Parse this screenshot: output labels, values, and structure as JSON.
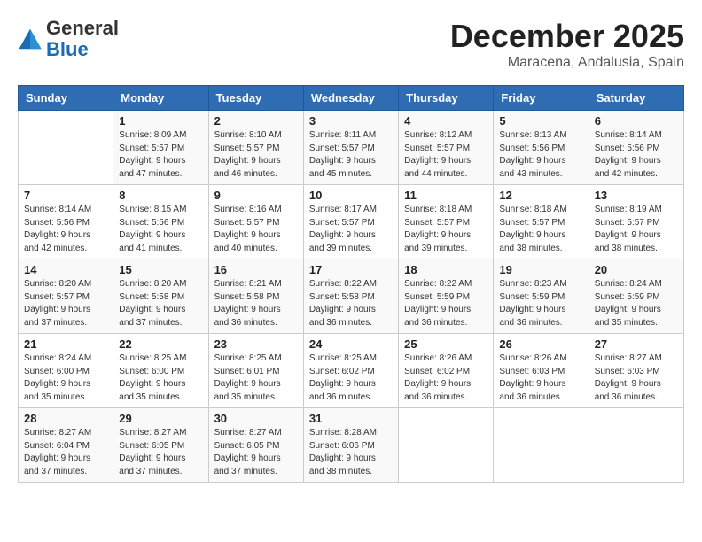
{
  "logo": {
    "general": "General",
    "blue": "Blue"
  },
  "header": {
    "month": "December 2025",
    "location": "Maracena, Andalusia, Spain"
  },
  "weekdays": [
    "Sunday",
    "Monday",
    "Tuesday",
    "Wednesday",
    "Thursday",
    "Friday",
    "Saturday"
  ],
  "weeks": [
    [
      {
        "day": "",
        "info": ""
      },
      {
        "day": "1",
        "info": "Sunrise: 8:09 AM\nSunset: 5:57 PM\nDaylight: 9 hours\nand 47 minutes."
      },
      {
        "day": "2",
        "info": "Sunrise: 8:10 AM\nSunset: 5:57 PM\nDaylight: 9 hours\nand 46 minutes."
      },
      {
        "day": "3",
        "info": "Sunrise: 8:11 AM\nSunset: 5:57 PM\nDaylight: 9 hours\nand 45 minutes."
      },
      {
        "day": "4",
        "info": "Sunrise: 8:12 AM\nSunset: 5:57 PM\nDaylight: 9 hours\nand 44 minutes."
      },
      {
        "day": "5",
        "info": "Sunrise: 8:13 AM\nSunset: 5:56 PM\nDaylight: 9 hours\nand 43 minutes."
      },
      {
        "day": "6",
        "info": "Sunrise: 8:14 AM\nSunset: 5:56 PM\nDaylight: 9 hours\nand 42 minutes."
      }
    ],
    [
      {
        "day": "7",
        "info": "Sunrise: 8:14 AM\nSunset: 5:56 PM\nDaylight: 9 hours\nand 42 minutes."
      },
      {
        "day": "8",
        "info": "Sunrise: 8:15 AM\nSunset: 5:56 PM\nDaylight: 9 hours\nand 41 minutes."
      },
      {
        "day": "9",
        "info": "Sunrise: 8:16 AM\nSunset: 5:57 PM\nDaylight: 9 hours\nand 40 minutes."
      },
      {
        "day": "10",
        "info": "Sunrise: 8:17 AM\nSunset: 5:57 PM\nDaylight: 9 hours\nand 39 minutes."
      },
      {
        "day": "11",
        "info": "Sunrise: 8:18 AM\nSunset: 5:57 PM\nDaylight: 9 hours\nand 39 minutes."
      },
      {
        "day": "12",
        "info": "Sunrise: 8:18 AM\nSunset: 5:57 PM\nDaylight: 9 hours\nand 38 minutes."
      },
      {
        "day": "13",
        "info": "Sunrise: 8:19 AM\nSunset: 5:57 PM\nDaylight: 9 hours\nand 38 minutes."
      }
    ],
    [
      {
        "day": "14",
        "info": "Sunrise: 8:20 AM\nSunset: 5:57 PM\nDaylight: 9 hours\nand 37 minutes."
      },
      {
        "day": "15",
        "info": "Sunrise: 8:20 AM\nSunset: 5:58 PM\nDaylight: 9 hours\nand 37 minutes."
      },
      {
        "day": "16",
        "info": "Sunrise: 8:21 AM\nSunset: 5:58 PM\nDaylight: 9 hours\nand 36 minutes."
      },
      {
        "day": "17",
        "info": "Sunrise: 8:22 AM\nSunset: 5:58 PM\nDaylight: 9 hours\nand 36 minutes."
      },
      {
        "day": "18",
        "info": "Sunrise: 8:22 AM\nSunset: 5:59 PM\nDaylight: 9 hours\nand 36 minutes."
      },
      {
        "day": "19",
        "info": "Sunrise: 8:23 AM\nSunset: 5:59 PM\nDaylight: 9 hours\nand 36 minutes."
      },
      {
        "day": "20",
        "info": "Sunrise: 8:24 AM\nSunset: 5:59 PM\nDaylight: 9 hours\nand 35 minutes."
      }
    ],
    [
      {
        "day": "21",
        "info": "Sunrise: 8:24 AM\nSunset: 6:00 PM\nDaylight: 9 hours\nand 35 minutes."
      },
      {
        "day": "22",
        "info": "Sunrise: 8:25 AM\nSunset: 6:00 PM\nDaylight: 9 hours\nand 35 minutes."
      },
      {
        "day": "23",
        "info": "Sunrise: 8:25 AM\nSunset: 6:01 PM\nDaylight: 9 hours\nand 35 minutes."
      },
      {
        "day": "24",
        "info": "Sunrise: 8:25 AM\nSunset: 6:02 PM\nDaylight: 9 hours\nand 36 minutes."
      },
      {
        "day": "25",
        "info": "Sunrise: 8:26 AM\nSunset: 6:02 PM\nDaylight: 9 hours\nand 36 minutes."
      },
      {
        "day": "26",
        "info": "Sunrise: 8:26 AM\nSunset: 6:03 PM\nDaylight: 9 hours\nand 36 minutes."
      },
      {
        "day": "27",
        "info": "Sunrise: 8:27 AM\nSunset: 6:03 PM\nDaylight: 9 hours\nand 36 minutes."
      }
    ],
    [
      {
        "day": "28",
        "info": "Sunrise: 8:27 AM\nSunset: 6:04 PM\nDaylight: 9 hours\nand 37 minutes."
      },
      {
        "day": "29",
        "info": "Sunrise: 8:27 AM\nSunset: 6:05 PM\nDaylight: 9 hours\nand 37 minutes."
      },
      {
        "day": "30",
        "info": "Sunrise: 8:27 AM\nSunset: 6:05 PM\nDaylight: 9 hours\nand 37 minutes."
      },
      {
        "day": "31",
        "info": "Sunrise: 8:28 AM\nSunset: 6:06 PM\nDaylight: 9 hours\nand 38 minutes."
      },
      {
        "day": "",
        "info": ""
      },
      {
        "day": "",
        "info": ""
      },
      {
        "day": "",
        "info": ""
      }
    ]
  ]
}
